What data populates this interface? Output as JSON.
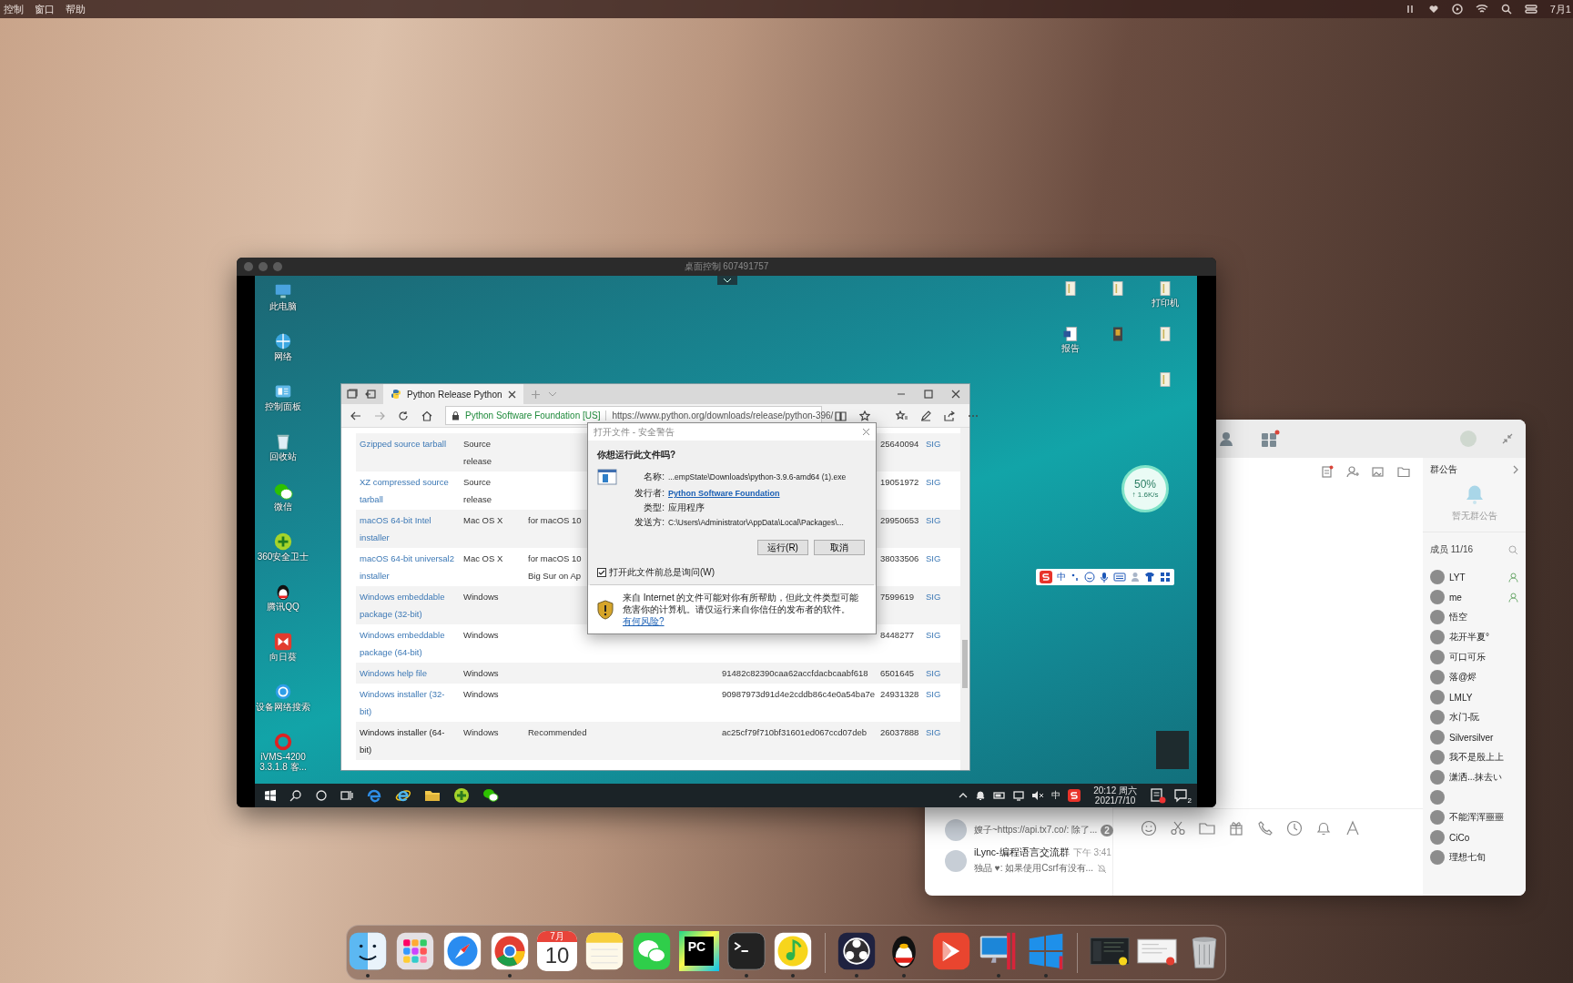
{
  "menubar": {
    "menus": [
      "控制",
      "窗口",
      "帮助"
    ],
    "clock": "7月1"
  },
  "remote_desktop": {
    "title": "桌面控制 607491757",
    "left_icons": [
      {
        "kind": "computer",
        "label": "此电脑"
      },
      {
        "kind": "network",
        "label": "网络"
      },
      {
        "kind": "control_panel",
        "label": "控制面板"
      },
      {
        "kind": "recycle_bin",
        "label": "回收站"
      },
      {
        "kind": "wechat",
        "label": "微信"
      },
      {
        "kind": "guard",
        "label": "360安全卫士"
      },
      {
        "kind": "qq",
        "label": "腾讯QQ"
      },
      {
        "kind": "sunflower",
        "label": "向日葵"
      },
      {
        "kind": "search",
        "label": "设备网络搜索"
      },
      {
        "kind": "ivms",
        "label": "iVMS-4200 3.3.1.8 客..."
      }
    ],
    "right_icons": [
      {
        "kind": "file"
      },
      {
        "kind": "file"
      },
      {
        "kind": "file",
        "label": "打印机"
      },
      {
        "kind": "word",
        "label": "报告"
      },
      {
        "kind": "archive"
      },
      {
        "kind": "file"
      },
      {
        "kind": "file"
      }
    ],
    "speed_widget": {
      "percent": "50%",
      "rate": "↑ 1.6K/s"
    },
    "ime_toolbar": {
      "mode": "中"
    },
    "taskbar": {
      "ime": "中",
      "time": "20:12 周六",
      "date": "2021/7/10",
      "notifications": "2"
    }
  },
  "browser": {
    "tab": "Python Release Python",
    "site": "Python Software Foundation [US]",
    "url": "https://www.python.org/downloads/release/python-396/",
    "rows": [
      {
        "name": "Gzipped source tarball",
        "os": "Source release",
        "size": "25640094",
        "sig": "SIG",
        "visited": false
      },
      {
        "name": "XZ compressed source tarball",
        "os": "Source release",
        "size": "19051972",
        "sig": "SIG",
        "visited": false
      },
      {
        "name": "macOS 64-bit Intel installer",
        "os": "Mac OS X",
        "description": "for macOS 10",
        "size": "29950653",
        "sig": "SIG",
        "visited": false
      },
      {
        "name": "macOS 64-bit universal2 installer",
        "os": "Mac OS X",
        "description": "for macOS 10\nBig Sur on Ap",
        "size": "38033506",
        "sig": "SIG",
        "visited": false
      },
      {
        "name": "Windows embeddable package (32-bit)",
        "os": "Windows",
        "size": "7599619",
        "sig": "SIG",
        "visited": false
      },
      {
        "name": "Windows embeddable package (64-bit)",
        "os": "Windows",
        "size": "8448277",
        "sig": "SIG",
        "visited": false
      },
      {
        "name": "Windows help file",
        "os": "Windows",
        "md5": "91482c82390caa62accfdacbcaabf618",
        "size": "6501645",
        "sig": "SIG",
        "visited": false
      },
      {
        "name": "Windows installer (32-bit)",
        "os": "Windows",
        "md5": "90987973d91d4e2cddb86c4e0a54ba7e",
        "size": "24931328",
        "sig": "SIG",
        "visited": false
      },
      {
        "name": "Windows installer (64-bit)",
        "os": "Windows",
        "description": "Recommended",
        "md5": "ac25cf79f710bf31601ed067ccd07deb",
        "size": "26037888",
        "sig": "SIG",
        "visited": true
      }
    ]
  },
  "dialog": {
    "title": "打开文件 - 安全警告",
    "question": "你想运行此文件吗?",
    "fields": [
      {
        "kind": "text",
        "label": "名称:",
        "value": "...empState\\Downloads\\python-3.9.6-amd64 (1).exe"
      },
      {
        "kind": "link",
        "label": "发行者:",
        "value": "Python Software Foundation"
      },
      {
        "kind": "text",
        "label": "类型:",
        "value": "应用程序"
      },
      {
        "kind": "text",
        "label": "发送方:",
        "value": "C:\\Users\\Administrator\\AppData\\Local\\Packages\\..."
      }
    ],
    "buttons": [
      "运行(R)",
      "取消"
    ],
    "always_ask": {
      "label": "打开此文件前总是询问(W)",
      "checked": true
    },
    "warning": "来自 Internet 的文件可能对你有所帮助，但此文件类型可能危害你的计算机。请仅运行来自你信任的发布者的软件。",
    "warning_link": "有何风险?"
  },
  "chat": {
    "conversations": [
      {
        "preview": "嫂子~https://api.tx7.co/: 除了...",
        "unread": "2",
        "muted": false
      },
      {
        "name": "iLync-编程语言交流群",
        "time": "下午 3:41",
        "preview": "独品 ♥: 如果使用Csrf有没有...",
        "muted": true
      }
    ],
    "notice_title": "群公告",
    "notice_empty": "暂无群公告",
    "members_label": "成员 11/16",
    "members": [
      {
        "name": "LYT",
        "admin": true
      },
      {
        "name": "me",
        "admin": true
      },
      {
        "name": "悟空",
        "admin": false
      },
      {
        "name": "花开半夏°",
        "admin": false
      },
      {
        "name": "可口可乐",
        "admin": false
      },
      {
        "name": "落@烬",
        "admin": false
      },
      {
        "name": "LMLY",
        "admin": false
      },
      {
        "name": "水门-阮",
        "admin": false
      },
      {
        "name": "Silversilver",
        "admin": false
      },
      {
        "name": "我不是殷上上",
        "admin": false
      },
      {
        "name": "潇洒...抹去い",
        "admin": false
      },
      {
        "admin": false
      },
      {
        "name": "不能浑浑噩噩",
        "admin": false
      },
      {
        "name": "CiCo",
        "admin": false
      },
      {
        "name": "理想七旬",
        "admin": false
      }
    ]
  },
  "dock": {
    "apps": [
      {
        "kind": "finder",
        "running": true
      },
      {
        "kind": "launchpad",
        "running": false
      },
      {
        "kind": "safari",
        "running": false
      },
      {
        "kind": "chrome",
        "running": true
      },
      {
        "kind": "calendar",
        "month": "7月",
        "day": "10",
        "running": false
      },
      {
        "kind": "notes",
        "running": false
      },
      {
        "kind": "wechat",
        "running": false
      },
      {
        "kind": "pycharm",
        "label": "PC",
        "running": false
      },
      {
        "kind": "terminal",
        "running": true
      },
      {
        "kind": "qqmusic",
        "running": true
      },
      {
        "kind": "separator"
      },
      {
        "kind": "obs",
        "running": true
      },
      {
        "kind": "qq",
        "running": true
      },
      {
        "kind": "redapp",
        "running": false
      },
      {
        "kind": "parallels",
        "running": true
      },
      {
        "kind": "windows",
        "running": true
      },
      {
        "kind": "separator"
      },
      {
        "kind": "thumb_dark",
        "running": false
      },
      {
        "kind": "thumb_light",
        "running": false
      },
      {
        "kind": "trash",
        "running": false
      }
    ]
  }
}
